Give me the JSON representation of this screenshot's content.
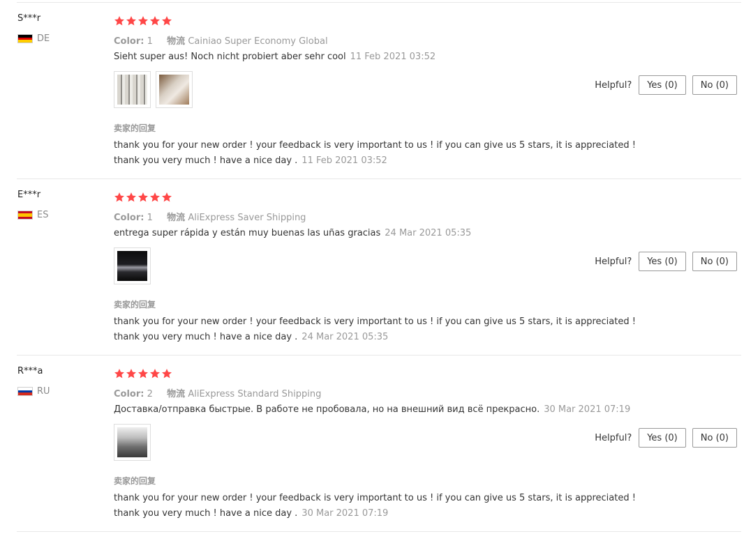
{
  "labels": {
    "color": "Color:",
    "shipping": "物流",
    "helpful": "Helpful?",
    "seller_reply": "卖家的回复"
  },
  "star_color": "#ff4747",
  "reviews": [
    {
      "user": "S***r",
      "country_code": "DE",
      "flag_icon": "germany-flag-icon",
      "rating": 5,
      "color_value": "1",
      "shipping": "Cainiao Super Economy Global",
      "text": "Sieht super aus! Noch nicht probiert aber sehr cool",
      "date": "11 Feb 2021 03:52",
      "images": [
        "review-photo-1",
        "review-photo-2"
      ],
      "yes": "Yes (0)",
      "no": "No (0)",
      "reply": "thank you for your new order ! your feedback is very important to us ! if you can give us 5 stars, it is appreciated ! thank you very much ! have a nice day .",
      "reply_date": "11 Feb 2021 03:52"
    },
    {
      "user": "E***r",
      "country_code": "ES",
      "flag_icon": "spain-flag-icon",
      "rating": 5,
      "color_value": "1",
      "shipping": "AliExpress Saver Shipping",
      "text": "entrega super rápida y están muy buenas las uñas gracias",
      "date": "24 Mar 2021 05:35",
      "images": [
        "review-photo-1"
      ],
      "yes": "Yes (0)",
      "no": "No (0)",
      "reply": "thank you for your new order ! your feedback is very important to us ! if you can give us 5 stars, it is appreciated ! thank you very much ! have a nice day .",
      "reply_date": "24 Mar 2021 05:35"
    },
    {
      "user": "R***a",
      "country_code": "RU",
      "flag_icon": "russia-flag-icon",
      "rating": 5,
      "color_value": "2",
      "shipping": "AliExpress Standard Shipping",
      "text": "Доставка/отправка быстрые. В работе не пробовала, но на внешний вид всё прекрасно.",
      "date": "30 Mar 2021 07:19",
      "images": [
        "review-photo-1"
      ],
      "yes": "Yes (0)",
      "no": "No (0)",
      "reply": "thank you for your new order ! your feedback is very important to us ! if you can give us 5 stars, it is appreciated ! thank you very much ! have a nice day .",
      "reply_date": "30 Mar 2021 07:19"
    }
  ]
}
